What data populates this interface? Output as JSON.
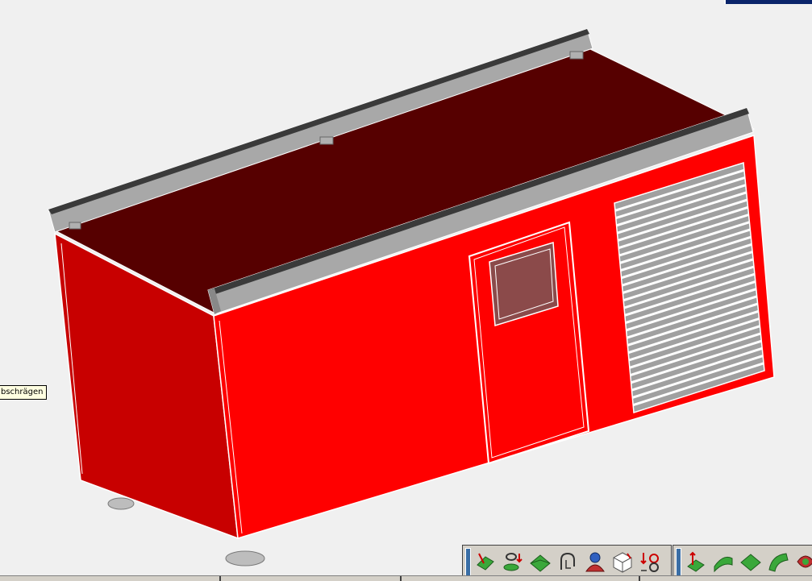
{
  "tooltip": {
    "text": "bschrägen"
  },
  "toolbar_a": {
    "icons": [
      "surface-arrow-icon",
      "revolve-arrow-icon",
      "surface-plane-icon",
      "wire-hook-icon",
      "person-icon",
      "cube-outline-icon",
      "curve-direction-icon"
    ]
  },
  "toolbar_b": {
    "icons": [
      "arrow-surface-icon",
      "swept-surface-icon",
      "flat-surface-icon",
      "curved-surface-icon",
      "colored-shape-icon"
    ]
  },
  "colors": {
    "background": "#f0f0f0",
    "container_side": "#ff0000",
    "container_end": "#c80000",
    "roof": "#560000",
    "roof_rail": "#a0a0a0",
    "toolbar": "#d4d0c8",
    "icon_green": "#3aa83a"
  }
}
